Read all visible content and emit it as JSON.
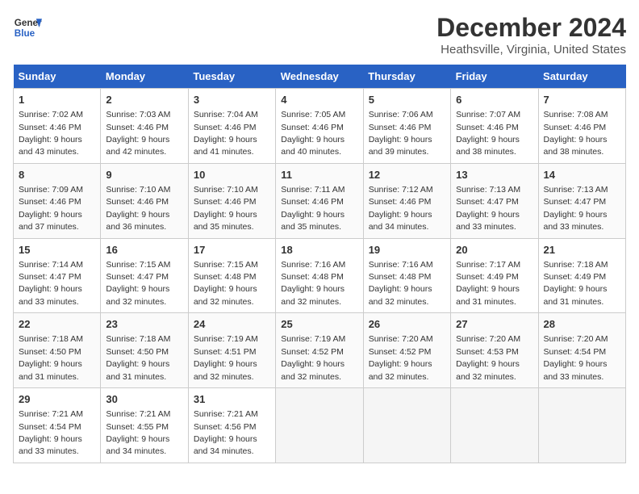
{
  "logo": {
    "line1": "General",
    "line2": "Blue"
  },
  "title": "December 2024",
  "location": "Heathsville, Virginia, United States",
  "days_of_week": [
    "Sunday",
    "Monday",
    "Tuesday",
    "Wednesday",
    "Thursday",
    "Friday",
    "Saturday"
  ],
  "weeks": [
    [
      {
        "day": 1,
        "sunrise": "7:02 AM",
        "sunset": "4:46 PM",
        "daylight": "9 hours and 43 minutes."
      },
      {
        "day": 2,
        "sunrise": "7:03 AM",
        "sunset": "4:46 PM",
        "daylight": "9 hours and 42 minutes."
      },
      {
        "day": 3,
        "sunrise": "7:04 AM",
        "sunset": "4:46 PM",
        "daylight": "9 hours and 41 minutes."
      },
      {
        "day": 4,
        "sunrise": "7:05 AM",
        "sunset": "4:46 PM",
        "daylight": "9 hours and 40 minutes."
      },
      {
        "day": 5,
        "sunrise": "7:06 AM",
        "sunset": "4:46 PM",
        "daylight": "9 hours and 39 minutes."
      },
      {
        "day": 6,
        "sunrise": "7:07 AM",
        "sunset": "4:46 PM",
        "daylight": "9 hours and 38 minutes."
      },
      {
        "day": 7,
        "sunrise": "7:08 AM",
        "sunset": "4:46 PM",
        "daylight": "9 hours and 38 minutes."
      }
    ],
    [
      {
        "day": 8,
        "sunrise": "7:09 AM",
        "sunset": "4:46 PM",
        "daylight": "9 hours and 37 minutes."
      },
      {
        "day": 9,
        "sunrise": "7:10 AM",
        "sunset": "4:46 PM",
        "daylight": "9 hours and 36 minutes."
      },
      {
        "day": 10,
        "sunrise": "7:10 AM",
        "sunset": "4:46 PM",
        "daylight": "9 hours and 35 minutes."
      },
      {
        "day": 11,
        "sunrise": "7:11 AM",
        "sunset": "4:46 PM",
        "daylight": "9 hours and 35 minutes."
      },
      {
        "day": 12,
        "sunrise": "7:12 AM",
        "sunset": "4:46 PM",
        "daylight": "9 hours and 34 minutes."
      },
      {
        "day": 13,
        "sunrise": "7:13 AM",
        "sunset": "4:47 PM",
        "daylight": "9 hours and 33 minutes."
      },
      {
        "day": 14,
        "sunrise": "7:13 AM",
        "sunset": "4:47 PM",
        "daylight": "9 hours and 33 minutes."
      }
    ],
    [
      {
        "day": 15,
        "sunrise": "7:14 AM",
        "sunset": "4:47 PM",
        "daylight": "9 hours and 33 minutes."
      },
      {
        "day": 16,
        "sunrise": "7:15 AM",
        "sunset": "4:47 PM",
        "daylight": "9 hours and 32 minutes."
      },
      {
        "day": 17,
        "sunrise": "7:15 AM",
        "sunset": "4:48 PM",
        "daylight": "9 hours and 32 minutes."
      },
      {
        "day": 18,
        "sunrise": "7:16 AM",
        "sunset": "4:48 PM",
        "daylight": "9 hours and 32 minutes."
      },
      {
        "day": 19,
        "sunrise": "7:16 AM",
        "sunset": "4:48 PM",
        "daylight": "9 hours and 32 minutes."
      },
      {
        "day": 20,
        "sunrise": "7:17 AM",
        "sunset": "4:49 PM",
        "daylight": "9 hours and 31 minutes."
      },
      {
        "day": 21,
        "sunrise": "7:18 AM",
        "sunset": "4:49 PM",
        "daylight": "9 hours and 31 minutes."
      }
    ],
    [
      {
        "day": 22,
        "sunrise": "7:18 AM",
        "sunset": "4:50 PM",
        "daylight": "9 hours and 31 minutes."
      },
      {
        "day": 23,
        "sunrise": "7:18 AM",
        "sunset": "4:50 PM",
        "daylight": "9 hours and 31 minutes."
      },
      {
        "day": 24,
        "sunrise": "7:19 AM",
        "sunset": "4:51 PM",
        "daylight": "9 hours and 32 minutes."
      },
      {
        "day": 25,
        "sunrise": "7:19 AM",
        "sunset": "4:52 PM",
        "daylight": "9 hours and 32 minutes."
      },
      {
        "day": 26,
        "sunrise": "7:20 AM",
        "sunset": "4:52 PM",
        "daylight": "9 hours and 32 minutes."
      },
      {
        "day": 27,
        "sunrise": "7:20 AM",
        "sunset": "4:53 PM",
        "daylight": "9 hours and 32 minutes."
      },
      {
        "day": 28,
        "sunrise": "7:20 AM",
        "sunset": "4:54 PM",
        "daylight": "9 hours and 33 minutes."
      }
    ],
    [
      {
        "day": 29,
        "sunrise": "7:21 AM",
        "sunset": "4:54 PM",
        "daylight": "9 hours and 33 minutes."
      },
      {
        "day": 30,
        "sunrise": "7:21 AM",
        "sunset": "4:55 PM",
        "daylight": "9 hours and 34 minutes."
      },
      {
        "day": 31,
        "sunrise": "7:21 AM",
        "sunset": "4:56 PM",
        "daylight": "9 hours and 34 minutes."
      },
      null,
      null,
      null,
      null
    ]
  ]
}
